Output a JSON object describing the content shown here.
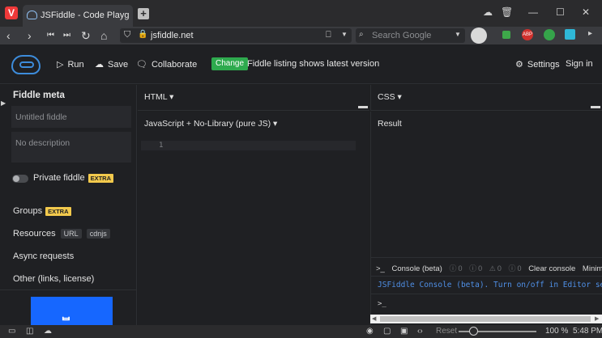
{
  "browser": {
    "tab_title": "JSFiddle - Code Playground",
    "url": "jsfiddle.net",
    "search_placeholder": "Search Google",
    "window_controls": [
      "minimize-icon",
      "maximize-icon",
      "close-icon"
    ]
  },
  "header": {
    "run_label": "Run",
    "save_label": "Save",
    "collaborate_label": "Collaborate",
    "change_badge": "Change",
    "listing_note": "Fiddle listing shows latest version",
    "settings_label": "Settings",
    "signin_label": "Sign in"
  },
  "sidebar": {
    "title": "Fiddle meta",
    "title_placeholder": "Untitled fiddle",
    "description_placeholder": "No description",
    "private_label": "Private fiddle",
    "extra_badge": "EXTRA",
    "groups_label": "Groups",
    "resources_label": "Resources",
    "resources_tags": [
      "URL",
      "cdnjs"
    ],
    "async_label": "Async requests",
    "other_label": "Other (links, license)"
  },
  "panes": {
    "html_label": "HTML ▾",
    "css_label": "CSS ▾",
    "js_label": "JavaScript + No-Library (pure JS) ▾",
    "result_label": "Result",
    "line_number": "1"
  },
  "console": {
    "title": "Console (beta)",
    "counts": [
      "0",
      "0",
      "0",
      "0"
    ],
    "clear_label": "Clear console",
    "minimize_label": "Minimize",
    "message": "JSFiddle Console (beta). Turn on/off in Editor settings",
    "prompt": ">_"
  },
  "statusbar": {
    "reset_label": "Reset",
    "zoom": "100 %",
    "time": "5:48 PM"
  },
  "colors": {
    "accent_blue": "#3d8cdb",
    "change_green": "#2eaa4e",
    "extra_yellow": "#f2c94c",
    "ad_blue": "#1667ff"
  }
}
